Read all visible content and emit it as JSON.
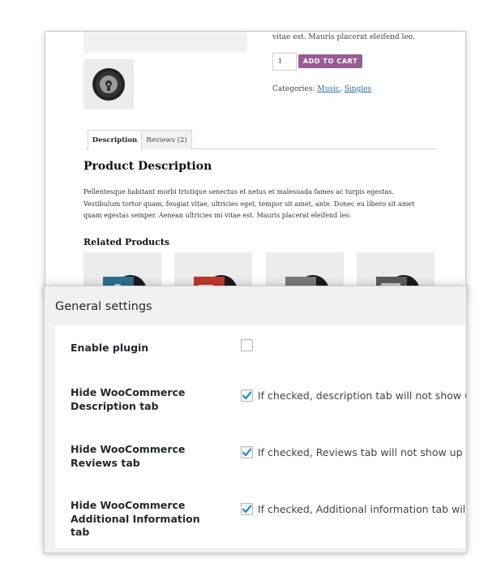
{
  "product": {
    "short_description_tail": "vitae est. Mauris placerat eleifend leo.",
    "quantity": "1",
    "add_to_cart_label": "ADD TO CART",
    "categories_label": "Categories:",
    "categories": [
      "Music",
      "Singles"
    ],
    "categories_separator": ",",
    "tabs": [
      {
        "label": "Description",
        "active": true
      },
      {
        "label": "Reviews (2)",
        "active": false
      }
    ],
    "description_heading": "Product Description",
    "description_text": "Pellentesque habitant morbi tristique senectus et netus et malesuada fames ac turpis egestas. Vestibulum tortor quam, feugiat vitae, ultricies eget, tempor sit amet, ante. Donec eu libero sit amet quam egestas semper. Aenean ultricies mi vitae est. Mauris placerat eleifend leo.",
    "related_heading": "Related Products",
    "related_items": [
      {
        "icon": "album-cover-icon",
        "accent": "#2f6f8f"
      },
      {
        "icon": "album-cover-icon",
        "accent": "#c0392b"
      },
      {
        "icon": "album-cover-icon",
        "accent": "#7a7a7a"
      },
      {
        "icon": "album-cover-icon",
        "accent": "#5c5c5c"
      }
    ],
    "button_color": "#9a5c94",
    "link_color": "#2b6db5"
  },
  "settings": {
    "title": "General settings",
    "rows": [
      {
        "label": "Enable plugin",
        "checked": false,
        "description": ""
      },
      {
        "label": "Hide WooCommerce Description tab",
        "checked": true,
        "description": "If checked, description tab will not show up"
      },
      {
        "label": "Hide WooCommerce Reviews tab",
        "checked": true,
        "description": "If checked, Reviews tab will not show up on"
      },
      {
        "label": "Hide WooCommerce Additional Information tab",
        "checked": true,
        "description": "If checked, Additional information tab will r"
      }
    ],
    "check_color": "#1e8cbe"
  }
}
